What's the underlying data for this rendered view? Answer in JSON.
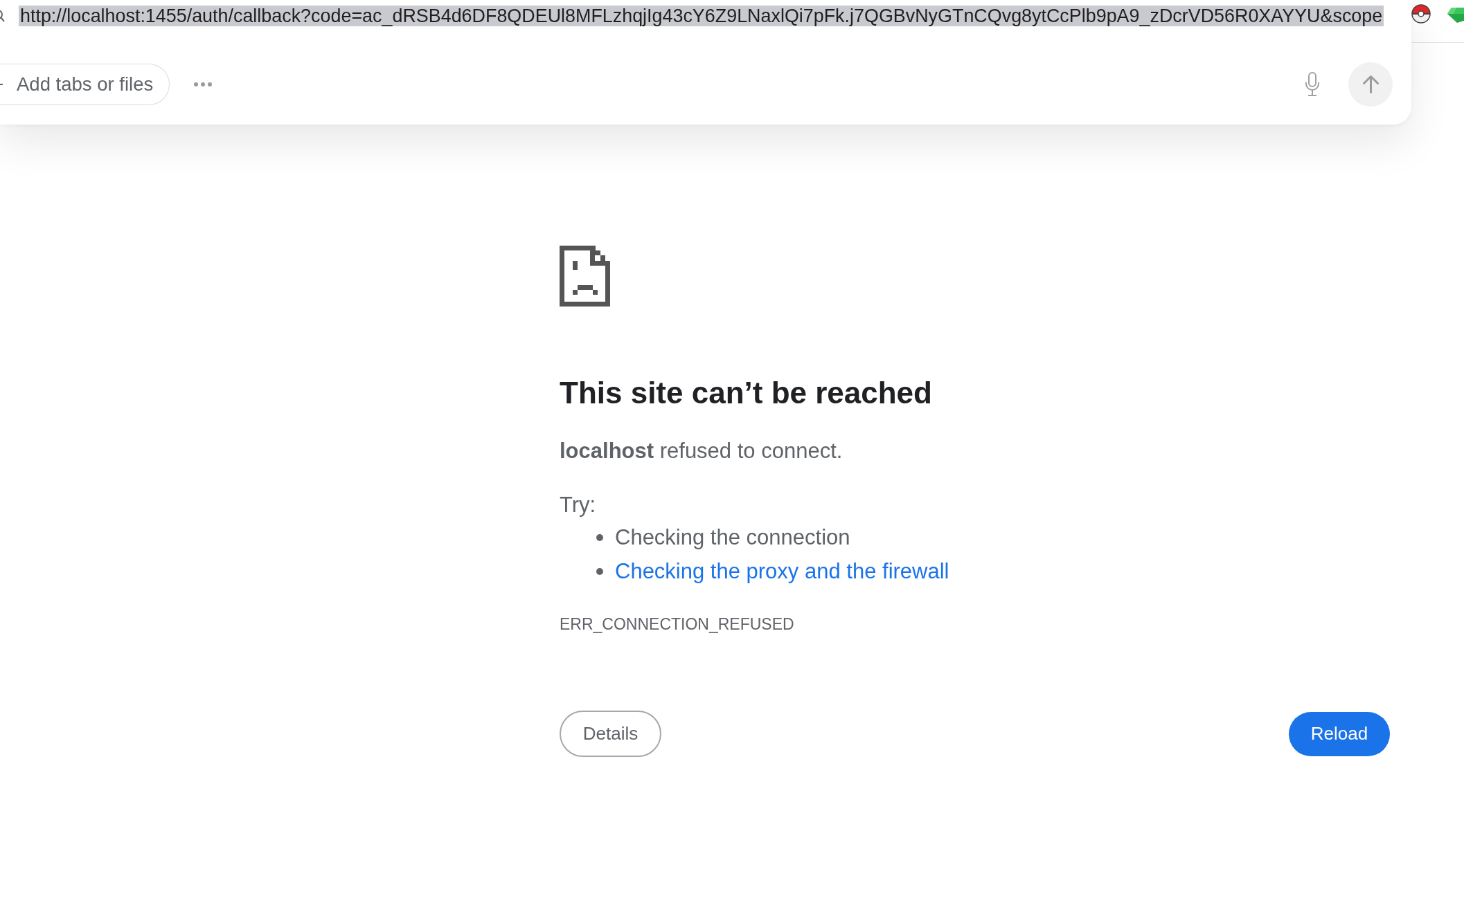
{
  "address_bar": {
    "url": "http://localhost:1455/auth/callback?code=ac_dRSB4d6DF8QDEUl8MFLzhqjIg43cY6Z9LNaxlQi7pFk.j7QGBvNyGTnCQvg8ytCcPlb9pA9_zDcrVD56R0XAYYU&scope",
    "selected": true
  },
  "composer": {
    "add_button": "Add tabs or files",
    "send_button": {
      "disabled": true
    }
  },
  "error_page": {
    "heading": "This site can’t be reached",
    "message": "**localhost** refused to connect.",
    "suggestions_label": "Try:",
    "suggestions": [
      {
        "text": "Checking the connection",
        "kind": "text"
      },
      {
        "text": "Checking the proxy and the firewall",
        "kind": "link"
      }
    ],
    "error_code": "ERR_CONNECTION_REFUSED",
    "buttons": [
      {
        "label": "Details",
        "kind": "secondary"
      },
      {
        "label": "Reload",
        "kind": "primary"
      }
    ]
  }
}
